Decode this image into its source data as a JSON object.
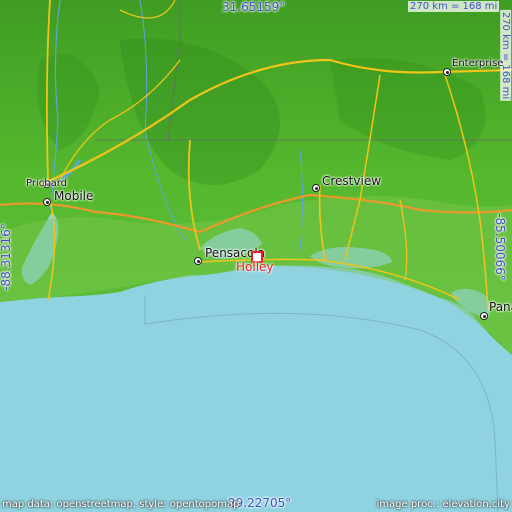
{
  "map": {
    "center_city": "Holley",
    "lat_top": "31.65159°",
    "lat_bottom": "29.22705°",
    "lon_left": "-88.31316°",
    "lon_right": "-85.50066°",
    "scale_horizontal": "270 km = 168 mi",
    "scale_vertical": "270 km = 168 mi",
    "credit_left": "map data: openstreetmap, style: opentopomap",
    "credit_right": "image proc.: elevation.city",
    "cities": [
      {
        "name": "Prichard"
      },
      {
        "name": "Mobile"
      },
      {
        "name": "Pensacola"
      },
      {
        "name": "Crestview"
      },
      {
        "name": "Enterprise"
      },
      {
        "name": "Pana"
      }
    ],
    "colors": {
      "water": "#8fd2e0",
      "land": "#4caf2a",
      "road": "#f0c419",
      "accent": "#e8202a",
      "coord_text": "#3f51c8"
    }
  }
}
